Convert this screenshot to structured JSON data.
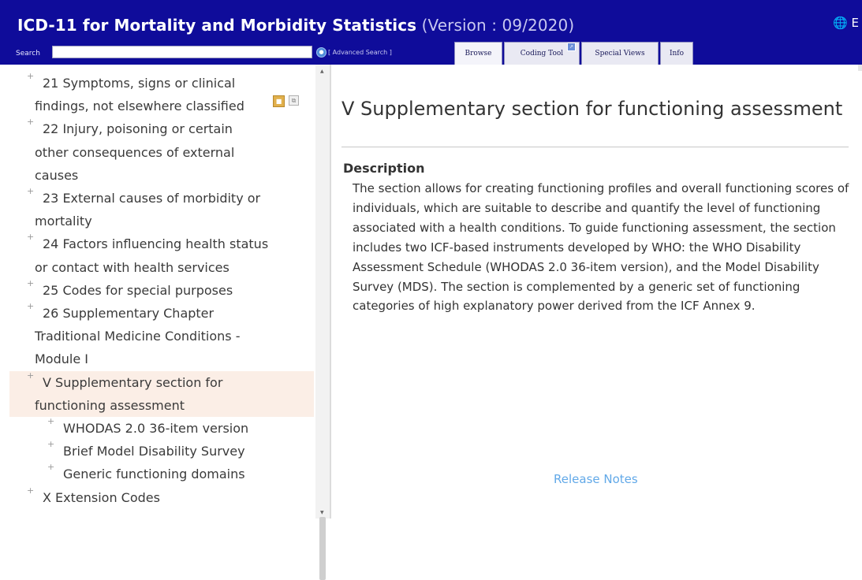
{
  "header": {
    "title_bold": "ICD-11 for Mortality and Morbidity Statistics",
    "title_version": "(Version : 09/2020)",
    "language": "E"
  },
  "search": {
    "label": "Search",
    "value": "",
    "advanced_label": "[ Advanced Search ]"
  },
  "tabs": {
    "browse": "Browse",
    "coding_tool": "Coding Tool",
    "special_views": "Special Views",
    "info": "Info"
  },
  "sidebar": {
    "items": [
      {
        "bullet": "+",
        "lines": [
          "21 Symptoms, signs or clinical",
          "findings, not elsewhere classified"
        ]
      },
      {
        "bullet": "+",
        "lines": [
          "22 Injury, poisoning or certain",
          "other consequences of external",
          "causes"
        ]
      },
      {
        "bullet": "+",
        "lines": [
          "23 External causes of morbidity or",
          "mortality"
        ]
      },
      {
        "bullet": "+",
        "lines": [
          "24 Factors influencing health status",
          "or contact with health services"
        ]
      },
      {
        "bullet": "+",
        "lines": [
          "25 Codes for special purposes"
        ]
      },
      {
        "bullet": "+",
        "lines": [
          "26 Supplementary Chapter",
          "Traditional Medicine Conditions -",
          "Module I"
        ]
      },
      {
        "bullet": "+",
        "lines": [
          "V Supplementary section for",
          "functioning assessment"
        ],
        "selected": true
      },
      {
        "bullet": "+",
        "lines": [
          "WHODAS 2.0 36-item version"
        ],
        "child": true
      },
      {
        "bullet": "+",
        "lines": [
          "Brief Model Disability Survey"
        ],
        "child": true
      },
      {
        "bullet": "+",
        "lines": [
          "Generic functioning domains"
        ],
        "child": true
      },
      {
        "bullet": "+",
        "lines": [
          "X Extension Codes"
        ]
      }
    ]
  },
  "content": {
    "title": "V Supplementary section for functioning assessment",
    "description_heading": "Description",
    "description": "The section allows for creating functioning profiles and overall functioning scores of individuals, which are suitable to describe and quantify the level of functioning associated with a health conditions. To guide functioning assessment, the section includes two ICF-based instruments developed by WHO: the WHO Disability Assessment Schedule (WHODAS 2.0 36-item version), and the Model Disability Survey (MDS). The section is complemented by a generic set of functioning categories of high explanatory power derived from the ICF Annex 9.",
    "release_notes": "Release Notes"
  },
  "colors": {
    "header_bg": "#0f0c9a",
    "selected_bg": "#fbeee6",
    "link": "#62a9e8"
  },
  "icons": [
    "globe-icon",
    "search-icon",
    "popout-icon",
    "concept-icon",
    "copy-icon"
  ]
}
